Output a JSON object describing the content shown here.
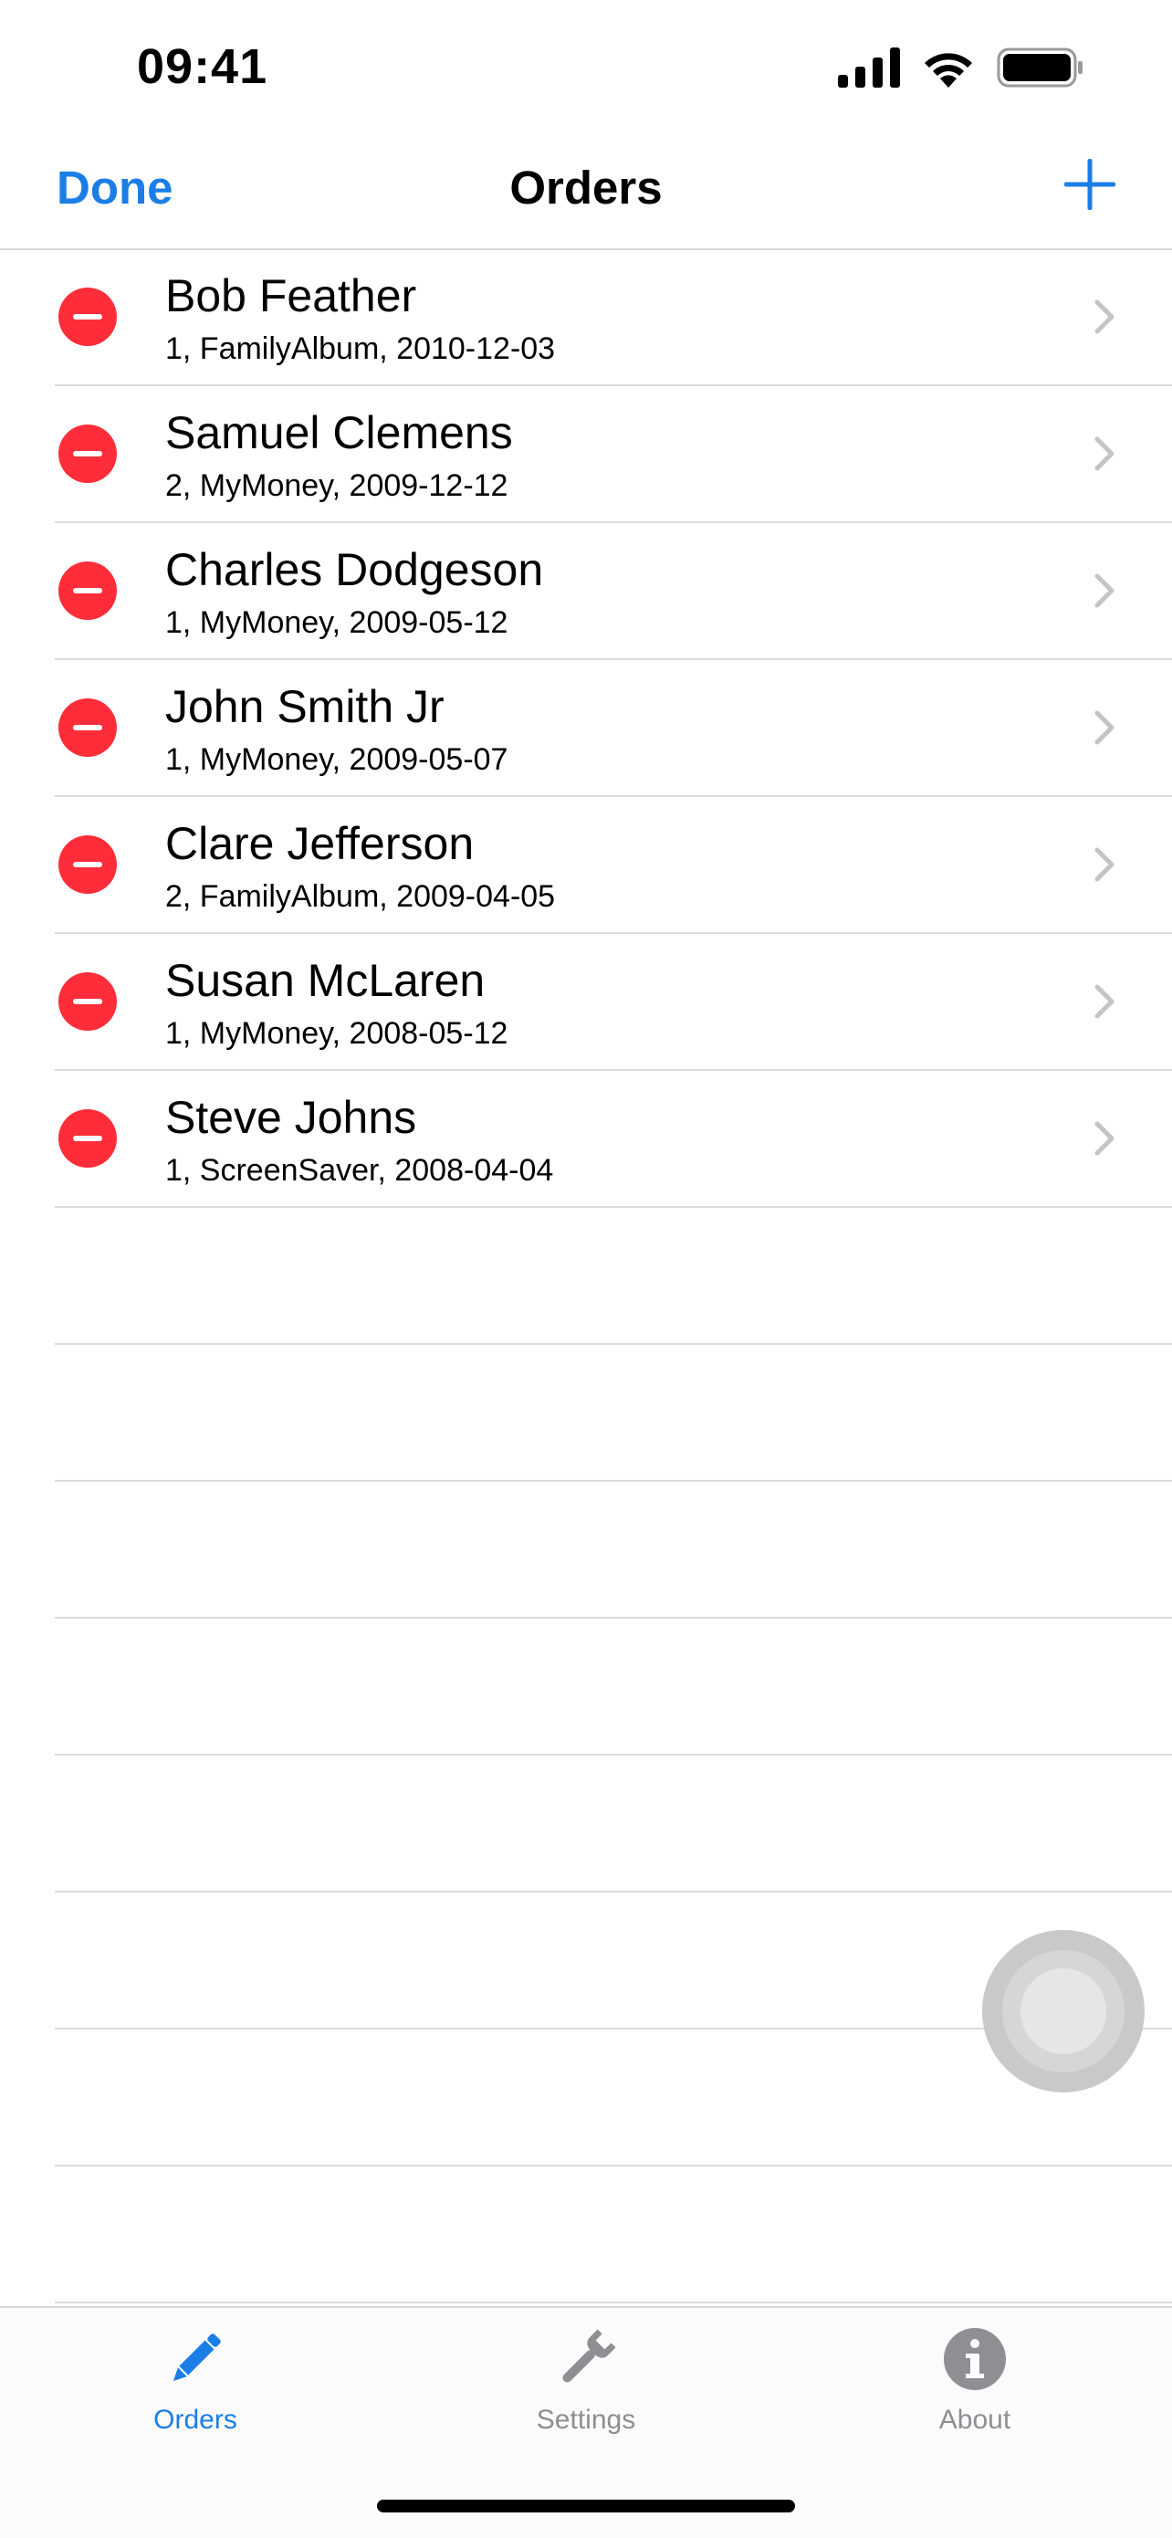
{
  "status_bar": {
    "time": "09:41"
  },
  "nav": {
    "done_label": "Done",
    "title": "Orders",
    "add_icon": "plus-icon"
  },
  "colors": {
    "accent": "#1b7ee6",
    "delete": "#ff2d3a",
    "inactive": "#8e8e93"
  },
  "orders": [
    {
      "name": "Bob Feather",
      "detail": "1, FamilyAlbum, 2010-12-03"
    },
    {
      "name": "Samuel Clemens",
      "detail": "2, MyMoney, 2009-12-12"
    },
    {
      "name": "Charles Dodgeson",
      "detail": "1, MyMoney, 2009-05-12"
    },
    {
      "name": "John Smith Jr",
      "detail": "1, MyMoney, 2009-05-07"
    },
    {
      "name": "Clare Jefferson",
      "detail": "2, FamilyAlbum, 2009-04-05"
    },
    {
      "name": "Susan McLaren",
      "detail": "1, MyMoney, 2008-05-12"
    },
    {
      "name": "Steve Johns",
      "detail": "1, ScreenSaver, 2008-04-04"
    }
  ],
  "tabs": [
    {
      "label": "Orders",
      "icon": "pencil-icon",
      "selected": true
    },
    {
      "label": "Settings",
      "icon": "wrench-icon",
      "selected": false
    },
    {
      "label": "About",
      "icon": "info-icon",
      "selected": false
    }
  ]
}
